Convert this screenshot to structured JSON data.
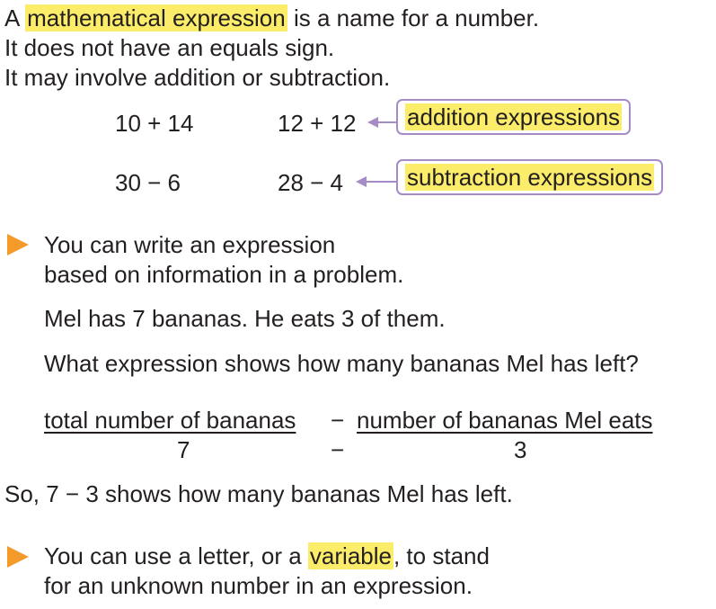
{
  "intro": {
    "line1_pre": "A ",
    "line1_term": "mathematical expression",
    "line1_post": " is a name for a number.",
    "line2": "It does not have an equals sign.",
    "line3": "It may involve addition or subtraction."
  },
  "examples": {
    "add1": "10 + 14",
    "add2": "12 + 12",
    "add_label": "addition expressions",
    "sub1": "30 − 6",
    "sub2": "28 − 4",
    "sub_label": "subtraction expressions"
  },
  "section1": {
    "line1": "You can write an expression",
    "line2": "based on information in a problem.",
    "problem": "Mel has 7 bananas. He eats 3 of them.",
    "question": "What expression shows how many bananas Mel has left?",
    "word_left": "total number of bananas",
    "word_op": "−",
    "word_right": "number of bananas Mel eats",
    "num_left": "7",
    "num_op": "−",
    "num_right": "3",
    "conclusion": "So, 7 − 3 shows how many bananas Mel has left."
  },
  "section2": {
    "line1_pre": "You can use a letter, or a ",
    "line1_term": "variable",
    "line1_post": ", to stand",
    "line2": "for an unknown number in an expression."
  },
  "colors": {
    "highlight": "#fbed6a",
    "box_border": "#a58cc6",
    "bullet": "#f39a2b"
  }
}
